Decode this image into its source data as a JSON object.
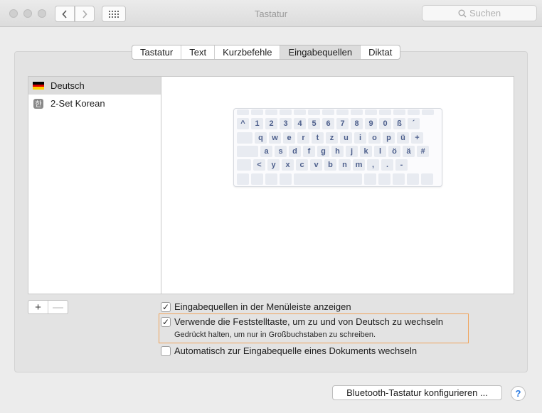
{
  "window": {
    "title": "Tastatur"
  },
  "search": {
    "placeholder": "Suchen"
  },
  "tabs": [
    {
      "label": "Tastatur",
      "active": false
    },
    {
      "label": "Text",
      "active": false
    },
    {
      "label": "Kurzbefehle",
      "active": false
    },
    {
      "label": "Eingabequellen",
      "active": true
    },
    {
      "label": "Diktat",
      "active": false
    }
  ],
  "sources": [
    {
      "label": "Deutsch",
      "icon": "german-flag-icon",
      "selected": true
    },
    {
      "label": "2-Set Korean",
      "icon": "korean-han-icon",
      "icon_glyph": "한",
      "selected": false
    }
  ],
  "keyboard": {
    "rows": [
      [
        "^",
        "1",
        "2",
        "3",
        "4",
        "5",
        "6",
        "7",
        "8",
        "9",
        "0",
        "ß",
        "´"
      ],
      [
        "q",
        "w",
        "e",
        "r",
        "t",
        "z",
        "u",
        "i",
        "o",
        "p",
        "ü",
        "+"
      ],
      [
        "a",
        "s",
        "d",
        "f",
        "g",
        "h",
        "j",
        "k",
        "l",
        "ö",
        "ä",
        "#"
      ],
      [
        "<",
        "y",
        "x",
        "c",
        "v",
        "b",
        "n",
        "m",
        ",",
        ".",
        "-"
      ]
    ]
  },
  "list_buttons": {
    "add": "+",
    "remove": "—"
  },
  "options": {
    "show_in_menubar": {
      "label": "Eingabequellen in der Menüleiste anzeigen",
      "checked": true
    },
    "capslock_switch": {
      "label": "Verwende die Feststelltaste, um zu und von Deutsch zu wechseln",
      "checked": true,
      "note": "Gedrückt halten, um nur in Großbuchstaben zu schreiben."
    },
    "auto_switch": {
      "label": "Automatisch zur Eingabequelle eines Dokuments wechseln",
      "checked": false
    }
  },
  "buttons": {
    "bluetooth": "Bluetooth-Tastatur konfigurieren ...",
    "help": "?"
  },
  "colors": {
    "highlight": "#f0a35a",
    "key_text": "#4d5f8c"
  }
}
